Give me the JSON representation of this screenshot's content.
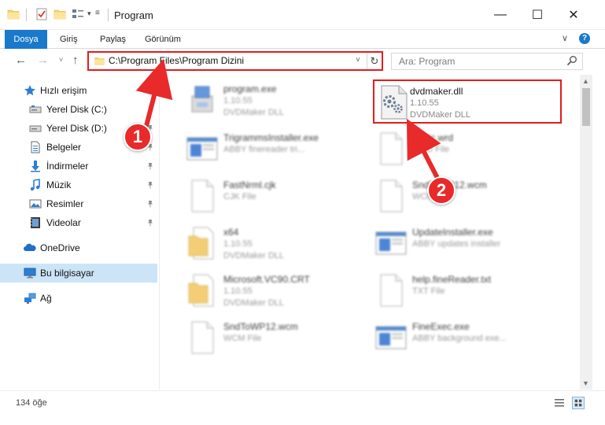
{
  "window": {
    "title": "Program",
    "min_glyph": "—",
    "max_glyph": "☐",
    "close_glyph": "✕"
  },
  "quick_access_toolbar": {
    "icons": [
      "folder-icon",
      "properties-icon",
      "new-folder-icon",
      "view-icon"
    ],
    "dropdown_glyph": "▾",
    "customize_glyph": "≡"
  },
  "ribbon": {
    "tabs": [
      "Dosya",
      "Giriş",
      "Paylaş",
      "Görünüm"
    ],
    "active_tab": "Dosya",
    "collapse_glyph": "∨",
    "help_glyph": "?"
  },
  "navigation": {
    "back_glyph": "←",
    "forward_glyph": "→",
    "recent_glyph": "˅",
    "up_glyph": "↑",
    "address": "C:\\Program Files\\Program Dizini",
    "address_dropdown_glyph": "˅",
    "refresh_glyph": "↻",
    "search_placeholder": "Ara: Program"
  },
  "sidebar": {
    "items": [
      {
        "label": "Hızlı erişim",
        "icon": "star-icon",
        "pinned": false
      },
      {
        "label": "Yerel Disk (C:)",
        "icon": "drive-icon",
        "pinned": true
      },
      {
        "label": "Yerel Disk (D:)",
        "icon": "drive-icon",
        "pinned": true
      },
      {
        "label": "Belgeler",
        "icon": "documents-icon",
        "pinned": true
      },
      {
        "label": "İndirmeler",
        "icon": "download-icon",
        "pinned": true
      },
      {
        "label": "Müzik",
        "icon": "music-icon",
        "pinned": true
      },
      {
        "label": "Resimler",
        "icon": "pictures-icon",
        "pinned": true
      },
      {
        "label": "Videolar",
        "icon": "video-icon",
        "pinned": true
      },
      {
        "label": "OneDrive",
        "icon": "cloud-icon",
        "pinned": false
      },
      {
        "label": "Bu bilgisayar",
        "icon": "computer-icon",
        "pinned": false,
        "selected": true
      },
      {
        "label": "Ağ",
        "icon": "network-icon",
        "pinned": false
      }
    ]
  },
  "files": [
    {
      "name": "program.exe",
      "line1": "1.10.55",
      "line2": "DVDMaker DLL",
      "icon": "installer-icon",
      "blurred": true
    },
    {
      "name": "dvdmaker.dll",
      "line1": "1.10.55",
      "line2": "DVDMaker DLL",
      "icon": "dll-gear-icon",
      "blurred": false,
      "highlighted": true
    },
    {
      "name": "TrigrammsInstaller.exe",
      "line1": "ABBY finereader tri...",
      "line2": "",
      "icon": "app-window-icon",
      "blurred": true
    },
    {
      "name": "Basic.wrd",
      "line1": "WRD File",
      "line2": "",
      "icon": "blank-file-icon",
      "blurred": true
    },
    {
      "name": "FastNrml.cjk",
      "line1": "CJK File",
      "line2": "",
      "icon": "blank-file-icon",
      "blurred": true
    },
    {
      "name": "SndToWP12.wcm",
      "line1": "WCM File",
      "line2": "",
      "icon": "blank-file-icon",
      "blurred": true
    },
    {
      "name": "x64",
      "line1": "1.10.55",
      "line2": "DVDMaker DLL",
      "icon": "folder-file-icon",
      "blurred": true
    },
    {
      "name": "UpdateInstaller.exe",
      "line1": "ABBY updates installer",
      "line2": "",
      "icon": "app-window-icon",
      "blurred": true
    },
    {
      "name": "Microsoft.VC90.CRT",
      "line1": "1.10.55",
      "line2": "DVDMaker DLL",
      "icon": "folder-file-icon",
      "blurred": true
    },
    {
      "name": "help.fineReader.txt",
      "line1": "TXT File",
      "line2": "",
      "icon": "blank-file-icon",
      "blurred": true
    },
    {
      "name": "SndToWP12.wcm",
      "line1": "WCM File",
      "line2": "",
      "icon": "blank-file-icon",
      "blurred": true
    },
    {
      "name": "FineExec.exe",
      "line1": "ABBY background exe...",
      "line2": "",
      "icon": "app-window-icon",
      "blurred": true
    }
  ],
  "status": {
    "item_count": "134 öğe"
  },
  "annotations": {
    "callout_1": "1",
    "callout_2": "2",
    "highlight_color": "#e21c1c",
    "callout_color": "#e82a2a"
  },
  "colors": {
    "accent": "#1979ca",
    "selection": "#cce4f7"
  }
}
